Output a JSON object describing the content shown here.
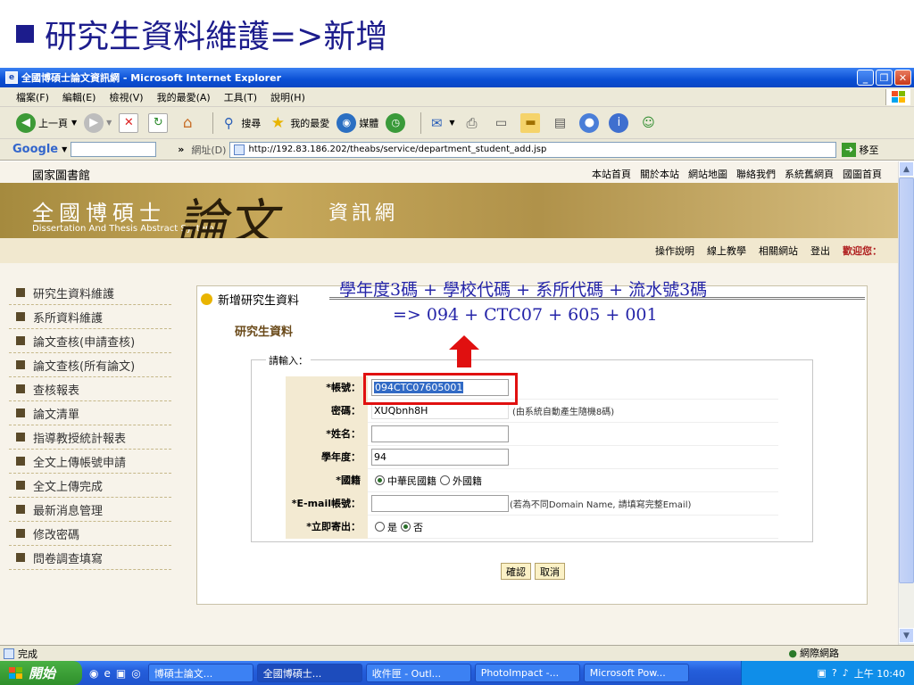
{
  "slide": {
    "title": "研究生資料維護=>新增"
  },
  "window": {
    "title": "全國博碩士論文資訊網 - Microsoft Internet Explorer",
    "controls": {
      "minimize": "_",
      "maximize": "❐",
      "close": "✕"
    }
  },
  "menu": [
    "檔案(F)",
    "編輯(E)",
    "檢視(V)",
    "我的最愛(A)",
    "工具(T)",
    "說明(H)"
  ],
  "toolbar": {
    "back": "上一頁",
    "search": "搜尋",
    "favorites": "我的最愛",
    "media": "媒體"
  },
  "addressbar": {
    "google": "Google",
    "google_arrow": "»",
    "label": "網址(D)",
    "url": "http://192.83.186.202/theabs/service/department_student_add.jsp",
    "go": "移至"
  },
  "site": {
    "library": "國家圖書館",
    "top_links": [
      "本站首頁",
      "關於本站",
      "網站地圖",
      "聯絡我們",
      "系統舊網頁",
      "國圖首頁"
    ],
    "brand": "全國博碩士",
    "brand_en": "Dissertation And Thesis Abstract  System",
    "brand_big": "論文",
    "brand_sub": "資訊網",
    "sub_links": [
      "操作說明",
      "線上教學",
      "相關網站",
      "登出"
    ],
    "welcome": "歡迎您："
  },
  "sidebar": [
    "研究生資料維護",
    "系所資料維護",
    "論文查核(申請查核)",
    "論文查核(所有論文)",
    "查核報表",
    "論文清單",
    "指導教授統計報表",
    "全文上傳帳號申請",
    "全文上傳完成",
    "最新消息管理",
    "修改密碼",
    "問卷調查填寫"
  ],
  "form": {
    "panel_title": "新增研究生資料",
    "section_title": "研究生資料",
    "legend": "請輸入：",
    "account_label": "*帳號：",
    "account_value": "094CTC07605001",
    "password_label": "密碼：",
    "password_value": "XUQbnh8H",
    "password_hint": "(由系統自動產生隨機8碼)",
    "name_label": "*姓名：",
    "name_value": "",
    "year_label": "學年度：",
    "year_value": "94",
    "nationality_label": "*國籍",
    "nationality_options": [
      "中華民國籍",
      "外國籍"
    ],
    "nationality_selected": "中華民國籍",
    "email_label": "*E-mail帳號：",
    "email_value": "",
    "email_hint": "(若為不同Domain Name, 請填寫完整Email)",
    "send_label": "*立即寄出：",
    "send_options": [
      "是",
      "否"
    ],
    "send_selected": "否",
    "confirm": "確認",
    "cancel": "取消"
  },
  "annotation": {
    "line1": "學年度3碼 + 學校代碼 + 系所代碼 + 流水號3碼",
    "line2": "=> 094 + CTC07 + 605 + 001",
    "highlight_color": "#e01010"
  },
  "status": {
    "text": "完成",
    "zone": "網際網路"
  },
  "taskbar": {
    "start": "開始",
    "tasks": [
      "博碩士論文...",
      "全國博碩士...",
      "收件匣 - Outl...",
      "PhotoImpact -...",
      "Microsoft Pow..."
    ],
    "clock": "上午 10:40"
  }
}
